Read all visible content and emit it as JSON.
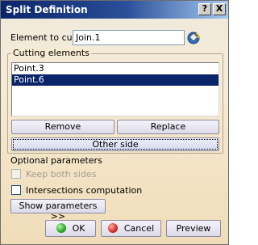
{
  "window": {
    "title": "Split Definition"
  },
  "titlebar": {
    "help_label": "?",
    "close_label": "X"
  },
  "element_to_cut": {
    "label": "Element to cut:",
    "value": "Join.1"
  },
  "cutting_elements": {
    "legend": "Cutting elements",
    "items": [
      {
        "label": "Point.3",
        "selected": false
      },
      {
        "label": "Point.6",
        "selected": true
      }
    ],
    "remove_label": "Remove",
    "replace_label": "Replace",
    "other_side_label": "Other side"
  },
  "optional": {
    "heading": "Optional parameters",
    "keep_both_sides_label": "Keep both sides",
    "intersections_label": "Intersections computation",
    "show_params_label": "Show parameters >>"
  },
  "footer": {
    "ok_label": "OK",
    "cancel_label": "Cancel",
    "preview_label": "Preview"
  },
  "colors": {
    "title_bar": "#0a246a",
    "selection": "#0a246a",
    "ok_icon": "#2fae2a",
    "cancel_icon": "#d8322a"
  },
  "icons": {
    "element_select": "paint-bucket-icon"
  }
}
